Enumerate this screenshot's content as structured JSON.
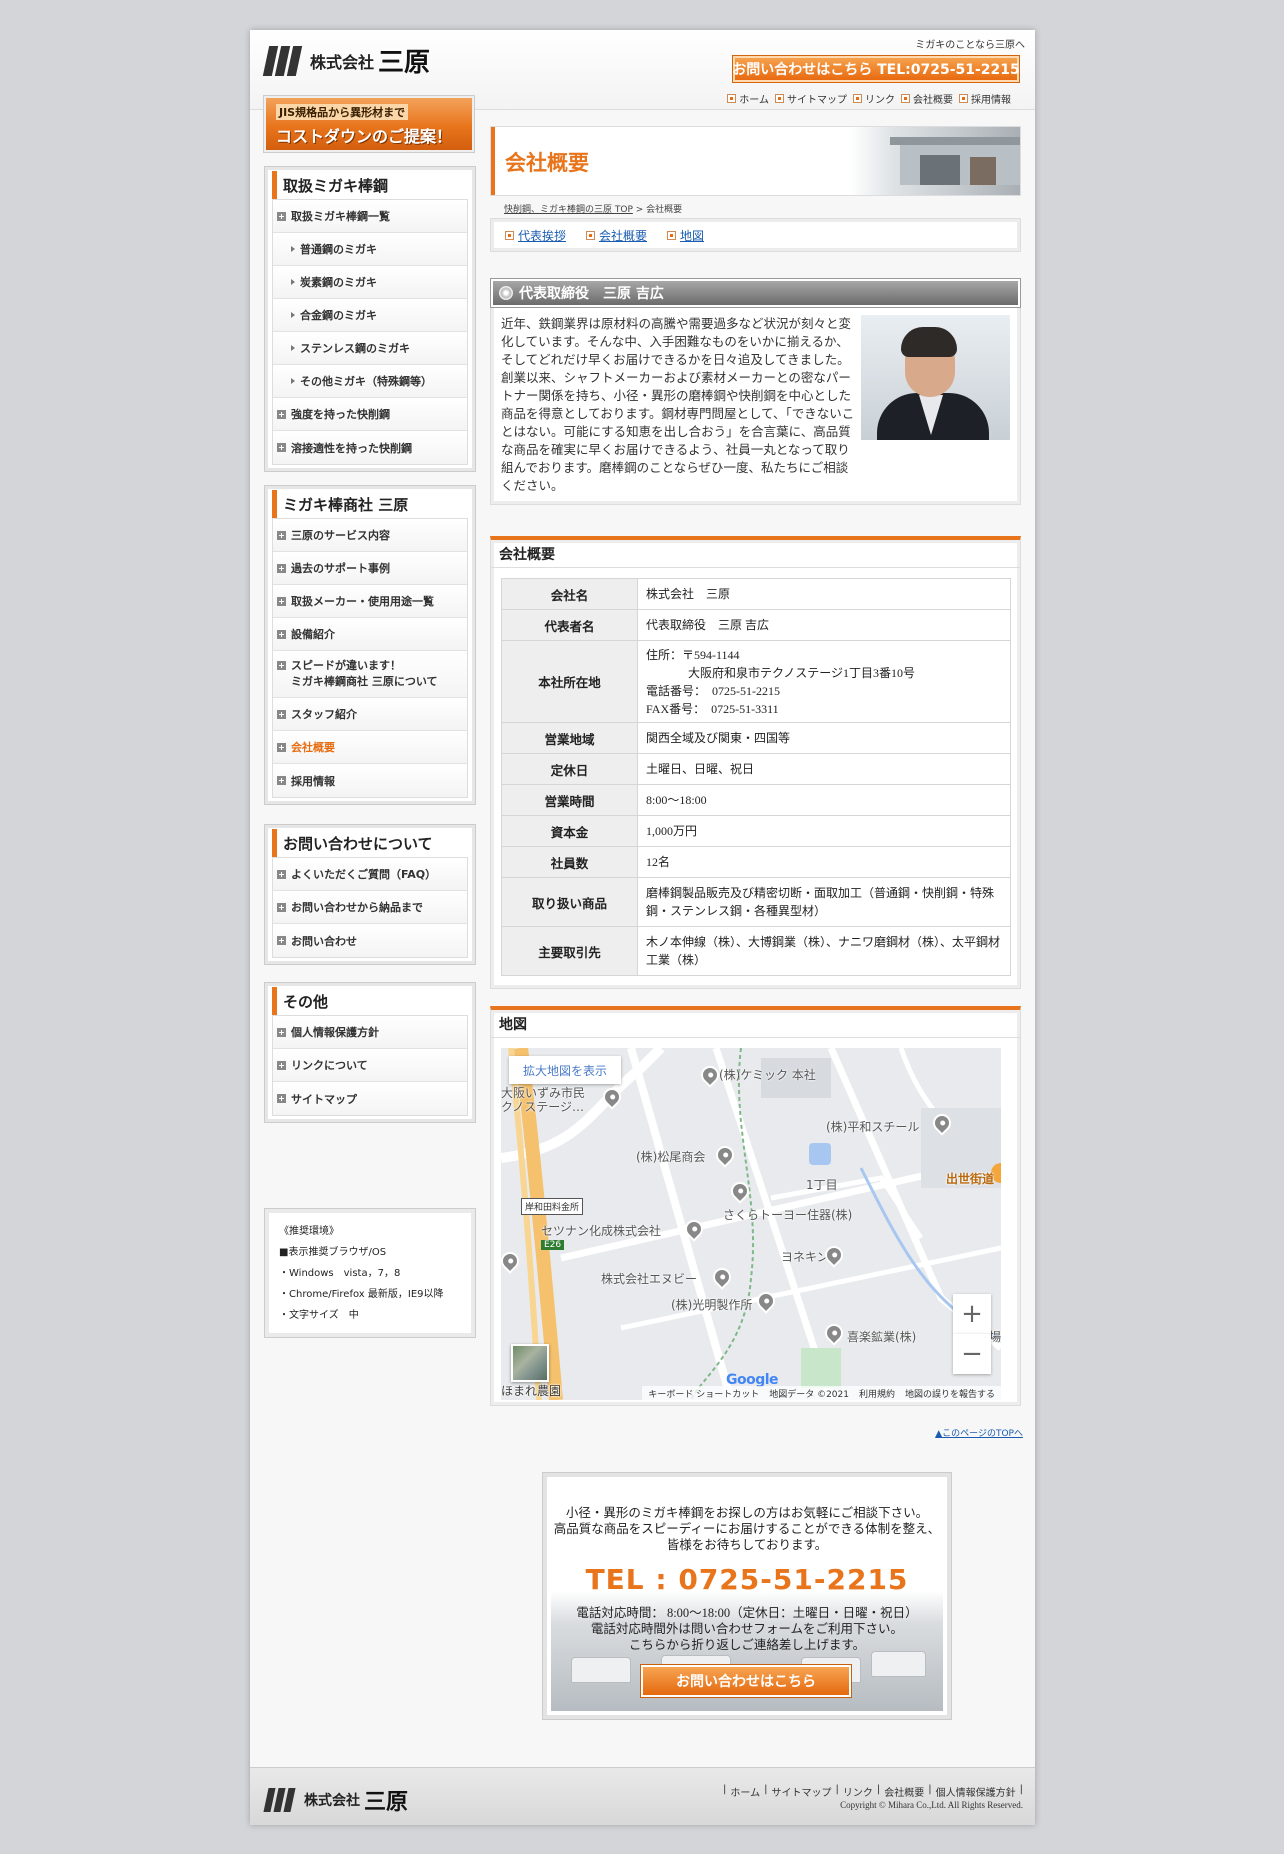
{
  "header": {
    "company_prefix": "株式会社",
    "company_name": "三原",
    "tagline": "ミガキのことなら三原へ",
    "contact_button": "お問い合わせはこちら TEL:0725-51-2215",
    "util_nav": [
      "ホーム",
      "サイトマップ",
      "リンク",
      "会社概要",
      "採用情報"
    ]
  },
  "sidebar": {
    "promo": {
      "line1": "JIS規格品から異形材まで",
      "line2": "コストダウンのご提案！"
    },
    "products": {
      "title": "取扱ミガキ棒鋼",
      "items": [
        "取扱ミガキ棒鋼一覧",
        "普通鋼のミガキ",
        "炭素鋼のミガキ",
        "合金鋼のミガキ",
        "ステンレス鋼のミガキ",
        "その他ミガキ（特殊鋼等）",
        "強度を持った快削鋼",
        "溶接適性を持った快削鋼"
      ]
    },
    "company": {
      "title": "ミガキ棒商社 三原",
      "items": [
        "三原のサービス内容",
        "過去のサポート事例",
        "取扱メーカー・使用用途一覧",
        "設備紹介",
        "スピードが違います！",
        "ミガキ棒鋼商社 三原について",
        "スタッフ紹介",
        "会社概要",
        "採用情報"
      ]
    },
    "inquiry": {
      "title": "お問い合わせについて",
      "items": [
        "よくいただくご質問（FAQ）",
        "お問い合わせから納品まで",
        "お問い合わせ"
      ]
    },
    "other": {
      "title": "その他",
      "items": [
        "個人情報保護方針",
        "リンクについて",
        "サイトマップ"
      ]
    },
    "env": [
      "《推奨環境》",
      "■表示推奨ブラウザ/OS",
      "・Windows　vista，7，8",
      "・Chrome/Firefox 最新版，IE9以降",
      "・文字サイズ　中"
    ]
  },
  "main": {
    "title": "会社概要",
    "breadcrumb": {
      "home": "快削鋼、ミガキ棒鋼の三原 TOP",
      "sep": " > ",
      "current": "会社概要"
    },
    "anchors": [
      "代表挨拶",
      "会社概要",
      "地図"
    ],
    "greeting": {
      "heading": "代表取締役　三原 吉広",
      "text": "近年、鉄鋼業界は原材料の高騰や需要過多など状況が刻々と変化しています。そんな中、入手困難なものをいかに揃えるか、そしてどれだけ早くお届けできるかを日々追及してきました。創業以来、シャフトメーカーおよび素材メーカーとの密なパートナー関係を持ち、小径・異形の磨棒鋼や快削鋼を中心とした商品を得意としております。鋼材専門問屋として、「できないことはない。可能にする知恵を出し合おう」を合言葉に、高品質な商品を確実に早くお届けできるよう、社員一丸となって取り組んでおります。磨棒鋼のことならぜひ一度、私たちにご相談ください。"
    },
    "company_info": {
      "heading": "会社概要",
      "rows": [
        {
          "label": "会社名",
          "value": "株式会社　三原"
        },
        {
          "label": "代表者名",
          "value": "代表取締役　三原 吉広"
        },
        {
          "label": "本社所在地",
          "lines": [
            "住所：〒594-1144",
            "大阪府和泉市テクノステージ1丁目3番10号",
            "電話番号：　0725-51-2215",
            "FAX番号：　0725-51-3311"
          ]
        },
        {
          "label": "営業地域",
          "value": "関西全域及び関東・四国等"
        },
        {
          "label": "定休日",
          "value": "土曜日、日曜、祝日"
        },
        {
          "label": "営業時間",
          "value": "8:00～18:00"
        },
        {
          "label": "資本金",
          "value": "1,000万円"
        },
        {
          "label": "社員数",
          "value": "12名"
        },
        {
          "label": "取り扱い商品",
          "value": "磨棒鋼製品販売及び精密切断・面取加工（普通鋼・快削鋼・特殊鋼・ステンレス鋼・各種異型材）"
        },
        {
          "label": "主要取引先",
          "value": "木ノ本伸線（株）、大博鋼業（株）、ナニワ磨鋼材（株）、太平鋼材工業（株）"
        }
      ]
    },
    "map": {
      "heading": "地図",
      "expand_button": "拡大地図を表示",
      "labels": [
        "(株)ケミック 本社",
        "大阪いずみ市民",
        "クノステージ…",
        "(株)平和スチール",
        "(株)松尾商会",
        "1丁目",
        "出世街道",
        "さくらトーヨー住器(株)",
        "セツナン化成株式会社",
        "ヨネキン",
        "株式会社エヌビー",
        "(株)光明製作所",
        "喜楽鉱業(株)",
        "場",
        "ほまれ農園"
      ],
      "toll_label": "岸和田料金所",
      "route": "E26",
      "google": "Google",
      "attribution": [
        "キーボード ショートカット",
        "地図データ ©2021",
        "利用規約",
        "地図の誤りを報告する"
      ],
      "zoom_in": "+",
      "zoom_out": "−"
    },
    "pagetop": "▲このページのTOPへ"
  },
  "contact_box": {
    "lines1": [
      "小径・異形のミガキ棒鋼をお探しの方はお気軽にご相談下さい。",
      "高品質な商品をスピーディーにお届けすることができる体制を整え、",
      "皆様をお待ちしております。"
    ],
    "tel": "TEL : 0725-51-2215",
    "lines2": [
      "電話対応時間： 8:00～18:00（定休日：土曜日・日曜・祝日）",
      "電話対応時間外は問い合わせフォームをご利用下さい。",
      "こちらから折り返しご連絡差し上げます。"
    ],
    "button": "お問い合わせはこちら"
  },
  "footer": {
    "company_prefix": "株式会社",
    "company_name": "三原",
    "nav": [
      "ホーム",
      "サイトマップ",
      "リンク",
      "会社概要",
      "個人情報保護方針"
    ],
    "copyright": "Copyright © Mihara Co.,Ltd. All Rights Reserved."
  },
  "colors": {
    "accent": "#e8741c",
    "link": "#1a5db0"
  }
}
